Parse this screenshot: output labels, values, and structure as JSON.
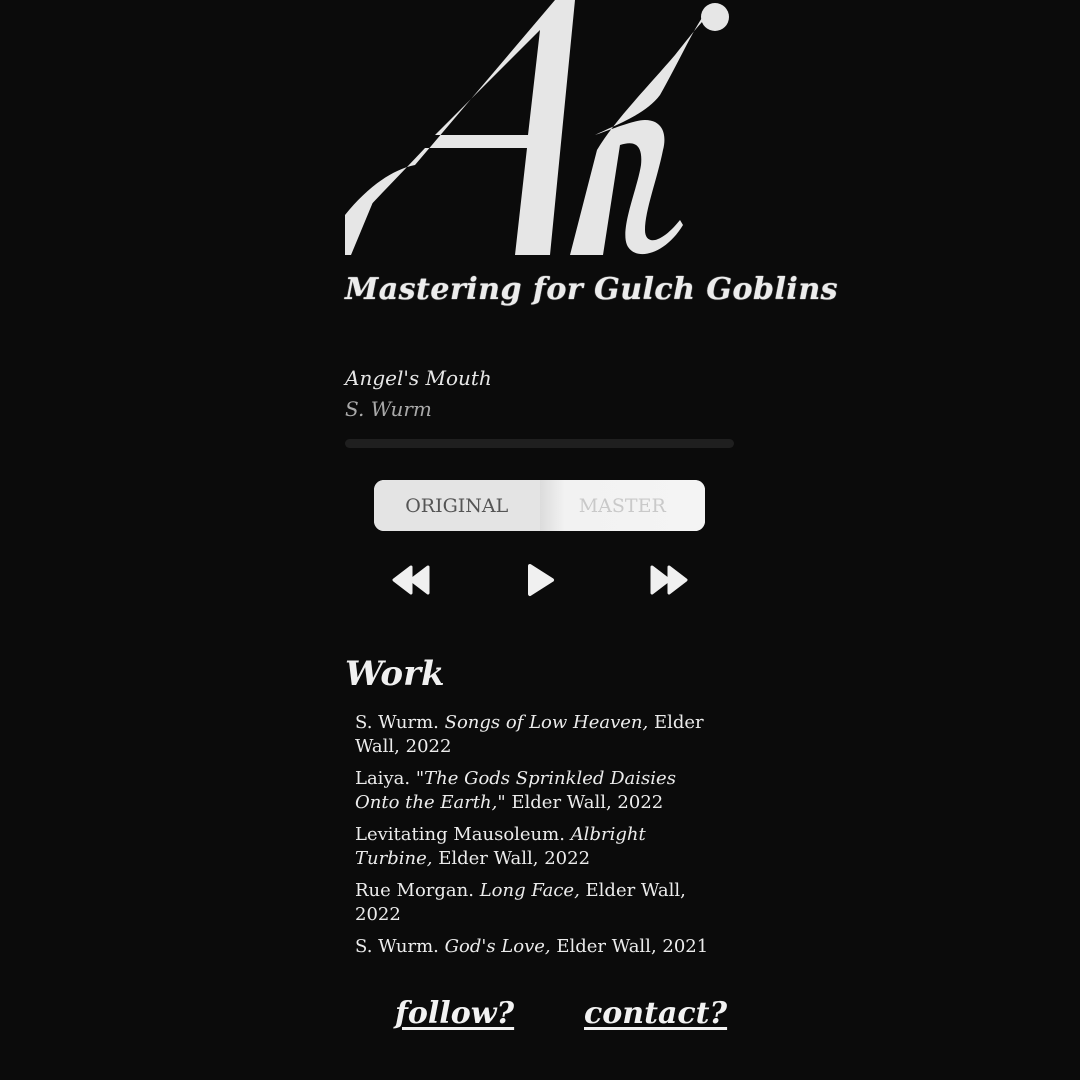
{
  "brand": {
    "logo_letters": "AK",
    "tagline": "Mastering for Gulch Goblins"
  },
  "player": {
    "track_title": "Angel's Mouth",
    "track_artist": "S. Wurm",
    "progress_fraction": 0,
    "toggle": {
      "original_label": "ORIGINAL",
      "master_label": "MASTER",
      "selected": "original"
    },
    "controls": {
      "rewind_icon": "rewind-icon",
      "play_icon": "play-icon",
      "forward_icon": "fast-forward-icon"
    }
  },
  "work": {
    "heading": "Work",
    "items": [
      {
        "artist": "S. Wurm.",
        "album": "Songs of Low Heaven,",
        "rest": "Elder Wall, 2022"
      },
      {
        "artist": "Laiya.",
        "album": "\"The Gods Sprinkled Daisies Onto the Earth,\"",
        "rest": "Elder Wall, 2022"
      },
      {
        "artist": "Levitating Mausoleum.",
        "album": "Albright Turbine,",
        "rest": "Elder Wall, 2022"
      },
      {
        "artist": "Rue Morgan.",
        "album": "Long Face,",
        "rest": "Elder Wall, 2022"
      },
      {
        "artist": "S. Wurm.",
        "album": "God's Love,",
        "rest": "Elder Wall, 2021"
      }
    ]
  },
  "footer": {
    "follow_label": "follow?",
    "contact_label": "contact?"
  }
}
